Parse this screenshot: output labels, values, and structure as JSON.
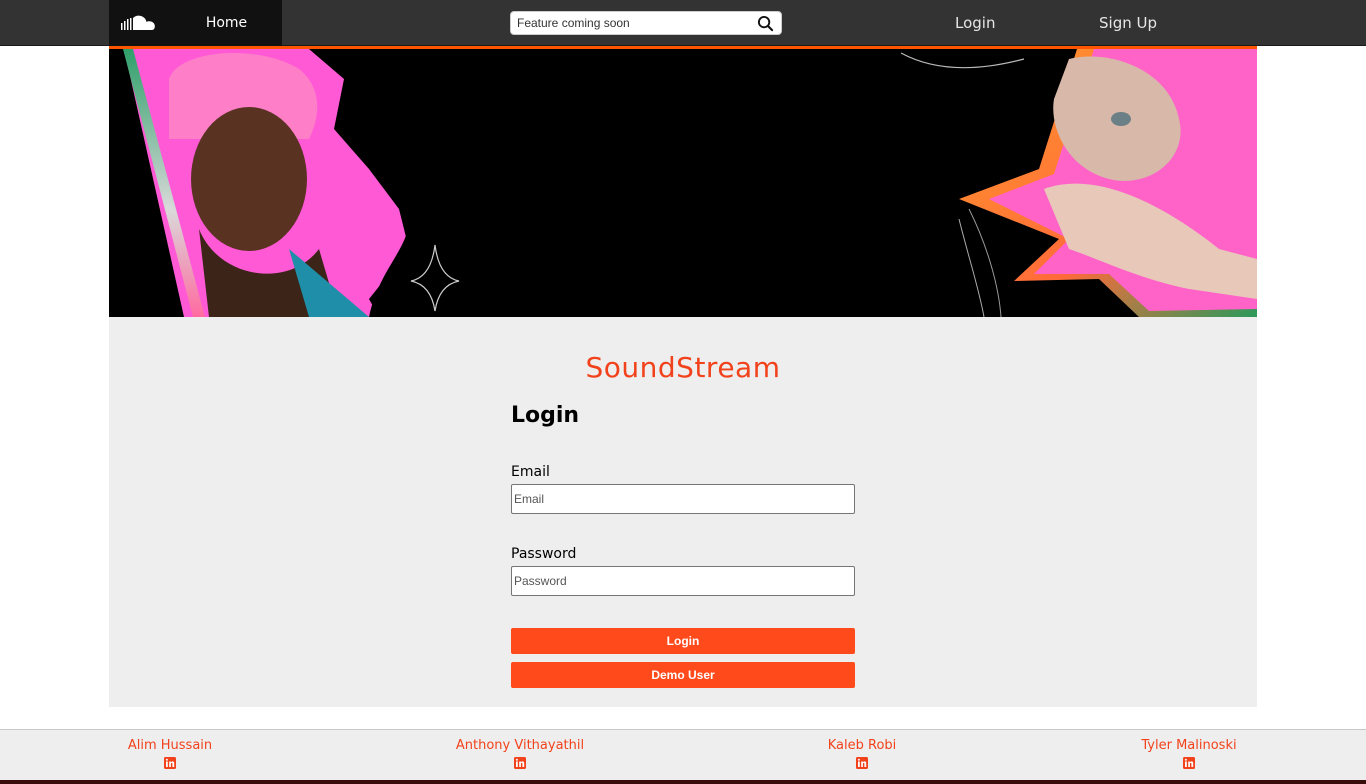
{
  "nav": {
    "logo_icon": "soundcloud-cloud-icon",
    "home_label": "Home",
    "search_placeholder": "Feature coming soon",
    "search_icon": "search-icon",
    "login_label": "Login",
    "signup_label": "Sign Up"
  },
  "hero": {
    "description_icon": "hero-banner-image"
  },
  "main": {
    "brand": "SoundStream",
    "form_title": "Login",
    "email_label": "Email",
    "email_placeholder": "Email",
    "password_label": "Password",
    "password_placeholder": "Password",
    "login_button": "Login",
    "demo_button": "Demo User"
  },
  "footer": {
    "developers": [
      {
        "name": "Alim Hussain",
        "icon": "linkedin-icon"
      },
      {
        "name": "Anthony Vithayathil",
        "icon": "linkedin-icon"
      },
      {
        "name": "Kaleb Robi",
        "icon": "linkedin-icon"
      },
      {
        "name": "Tyler Malinoski",
        "icon": "linkedin-icon"
      }
    ]
  },
  "colors": {
    "accent": "#ff5500",
    "brand_text": "#f2421b",
    "button": "#ff4a1c",
    "nav_bg": "#333333",
    "card_bg": "#eeeeee"
  }
}
